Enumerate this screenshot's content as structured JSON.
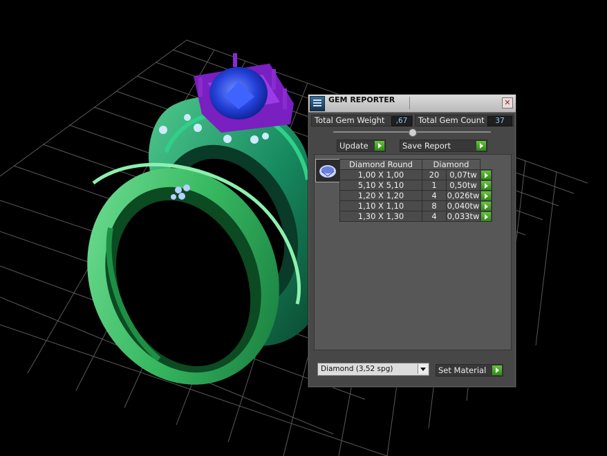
{
  "panel": {
    "title": "GEM REPORTER",
    "close_label": "✕",
    "total_gem_weight_label": "Total Gem Weight",
    "total_gem_weight_value": ",67",
    "total_gem_count_label": "Total Gem Count",
    "total_gem_count_value": "37",
    "update_label": "Update",
    "save_report_label": "Save Report",
    "table_headers": [
      "Diamond Round",
      "Diamond"
    ],
    "rows": [
      {
        "size": "1,00 X 1,00",
        "count": "20",
        "weight": "0,07tw"
      },
      {
        "size": "5,10 X 5,10",
        "count": "1",
        "weight": "0,50tw"
      },
      {
        "size": "1,20 X 1,20",
        "count": "4",
        "weight": "0,026tw"
      },
      {
        "size": "1,10 X 1,10",
        "count": "8",
        "weight": "0,040tw"
      },
      {
        "size": "1,30 X 1,30",
        "count": "4",
        "weight": "0,033tw"
      }
    ],
    "material_select_value": "Diamond    (3,52 spg)",
    "set_material_label": "Set Material"
  },
  "colors": {
    "ring_green": "#39b963",
    "ring_dark_green": "#178a60",
    "setting_purple": "#8a2bd0",
    "gem_blue": "#1f40d8",
    "accent_green": "#4fae2a"
  }
}
